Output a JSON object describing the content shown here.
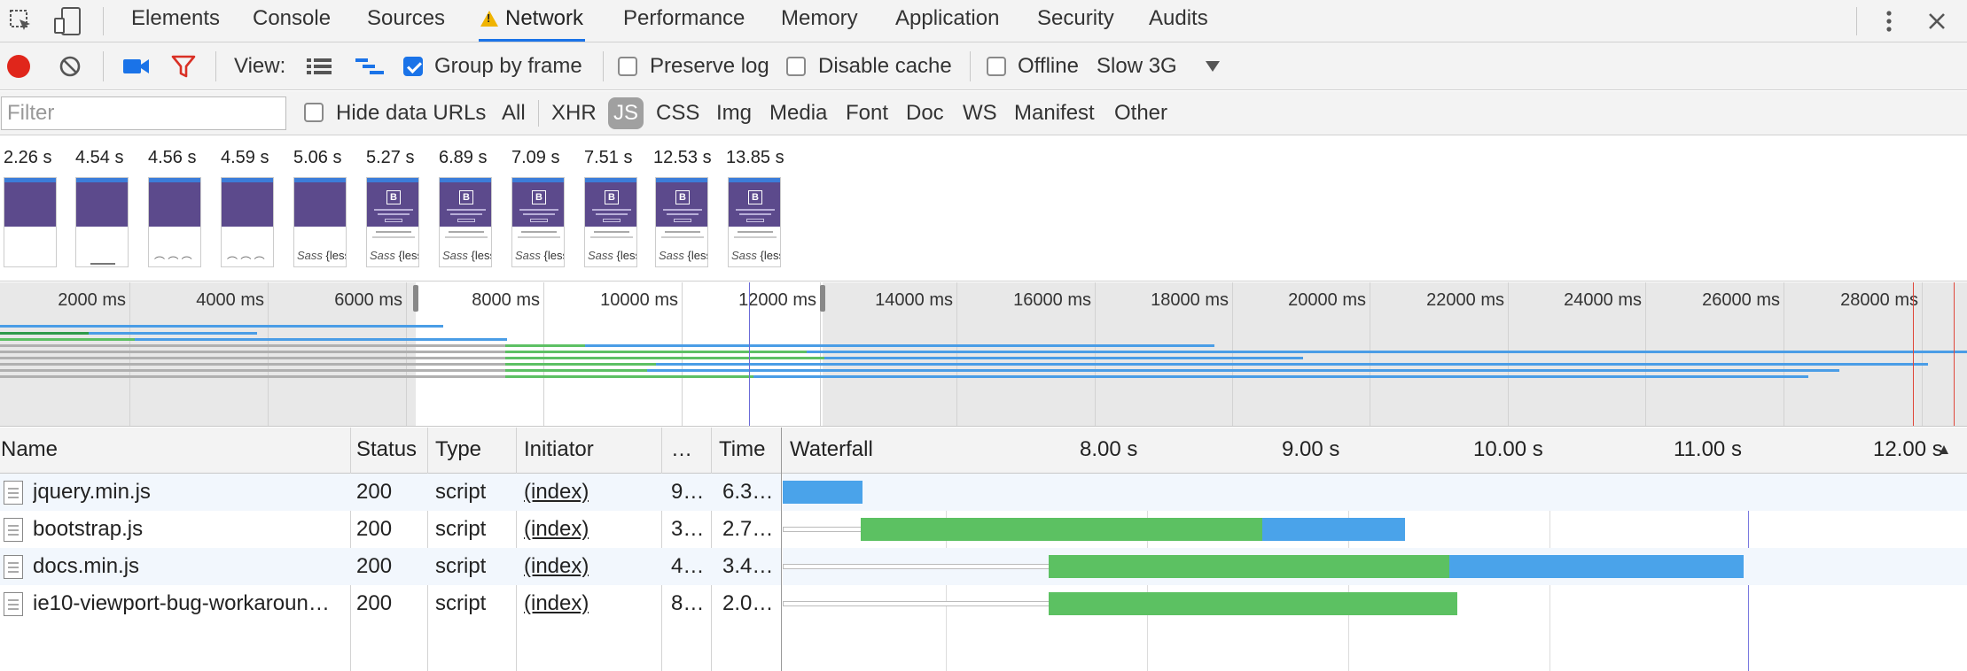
{
  "tabs": [
    "Elements",
    "Console",
    "Sources",
    "Network",
    "Performance",
    "Memory",
    "Application",
    "Security",
    "Audits"
  ],
  "active_tab": "Network",
  "toolbar": {
    "view_label": "View:",
    "group_by_frame": "Group by frame",
    "group_by_frame_checked": true,
    "preserve_log": "Preserve log",
    "disable_cache": "Disable cache",
    "offline": "Offline",
    "throttle": "Slow 3G"
  },
  "filterbar": {
    "placeholder": "Filter",
    "hide_data_urls": "Hide data URLs",
    "types": [
      "All",
      "XHR",
      "JS",
      "CSS",
      "Img",
      "Media",
      "Font",
      "Doc",
      "WS",
      "Manifest",
      "Other"
    ],
    "active_type": "JS"
  },
  "filmstrip": {
    "times": [
      "2.26 s",
      "4.54 s",
      "4.56 s",
      "4.59 s",
      "5.06 s",
      "5.27 s",
      "6.89 s",
      "7.09 s",
      "7.51 s",
      "12.53 s",
      "13.85 s"
    ],
    "sass_text": "Sass",
    "less_text": "{less}"
  },
  "overview": {
    "ticks": [
      "2000 ms",
      "4000 ms",
      "6000 ms",
      "8000 ms",
      "10000 ms",
      "12000 ms",
      "14000 ms",
      "16000 ms",
      "18000 ms",
      "20000 ms",
      "22000 ms",
      "24000 ms",
      "26000 ms",
      "28000 ms"
    ]
  },
  "table": {
    "columns": [
      "Name",
      "Status",
      "Type",
      "Initiator",
      "…",
      "Time",
      "Waterfall"
    ],
    "waterfall_ticks": [
      "8.00 s",
      "9.00 s",
      "10.00 s",
      "11.00 s",
      "12.00 s"
    ],
    "rows": [
      {
        "name": "jquery.min.js",
        "status": "200",
        "type": "script",
        "initiator": "(index)",
        "size": "9…",
        "time": "6.3…"
      },
      {
        "name": "bootstrap.js",
        "status": "200",
        "type": "script",
        "initiator": "(index)",
        "size": "3…",
        "time": "2.7…"
      },
      {
        "name": "docs.min.js",
        "status": "200",
        "type": "script",
        "initiator": "(index)",
        "size": "4…",
        "time": "3.4…"
      },
      {
        "name": "ie10-viewport-bug-workaroun…",
        "status": "200",
        "type": "script",
        "initiator": "(index)",
        "size": "8…",
        "time": "2.0…"
      }
    ]
  },
  "colors": {
    "accent": "#1a73e8",
    "record": "#e0261b",
    "waiting": "#5cc162",
    "download": "#4aa3ea"
  }
}
